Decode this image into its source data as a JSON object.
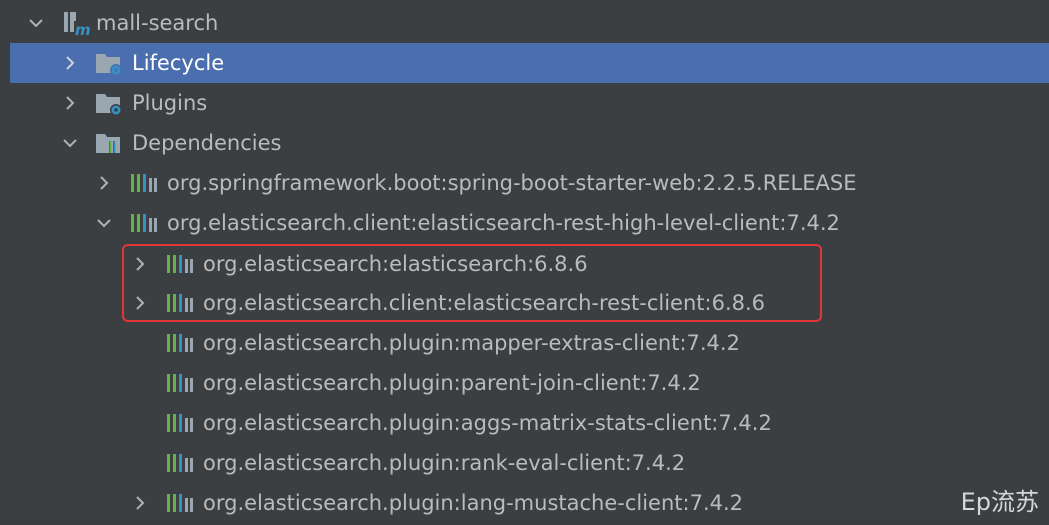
{
  "tree": {
    "root": {
      "label": "mall-search",
      "icon": "maven-module-icon",
      "expanded": true
    },
    "lifecycle": {
      "label": "Lifecycle",
      "icon": "lifecycle-folder-icon",
      "expanded": false,
      "selected": true
    },
    "plugins": {
      "label": "Plugins",
      "icon": "plugins-folder-icon",
      "expanded": false
    },
    "dependencies": {
      "label": "Dependencies",
      "icon": "dependencies-folder-icon",
      "expanded": true,
      "items": [
        {
          "label": "org.springframework.boot:spring-boot-starter-web:2.2.5.RELEASE",
          "expandable": true,
          "expanded": false
        },
        {
          "label": "org.elasticsearch.client:elasticsearch-rest-high-level-client:7.4.2",
          "expandable": true,
          "expanded": true,
          "children": [
            {
              "label": "org.elasticsearch:elasticsearch:6.8.6",
              "expandable": true,
              "expanded": false,
              "highlighted": true
            },
            {
              "label": "org.elasticsearch.client:elasticsearch-rest-client:6.8.6",
              "expandable": true,
              "expanded": false,
              "highlighted": true
            },
            {
              "label": "org.elasticsearch.plugin:mapper-extras-client:7.4.2",
              "expandable": false
            },
            {
              "label": "org.elasticsearch.plugin:parent-join-client:7.4.2",
              "expandable": false
            },
            {
              "label": "org.elasticsearch.plugin:aggs-matrix-stats-client:7.4.2",
              "expandable": false
            },
            {
              "label": "org.elasticsearch.plugin:rank-eval-client:7.4.2",
              "expandable": false
            },
            {
              "label": "org.elasticsearch.plugin:lang-mustache-client:7.4.2",
              "expandable": true,
              "expanded": false
            }
          ]
        }
      ]
    }
  },
  "watermark": "Ep流苏",
  "colors": {
    "background": "#3c3f41",
    "selection": "#4b6eaf",
    "text": "#bbbbbb",
    "highlight_border": "#e0373b",
    "library_icon": "#62b543"
  }
}
